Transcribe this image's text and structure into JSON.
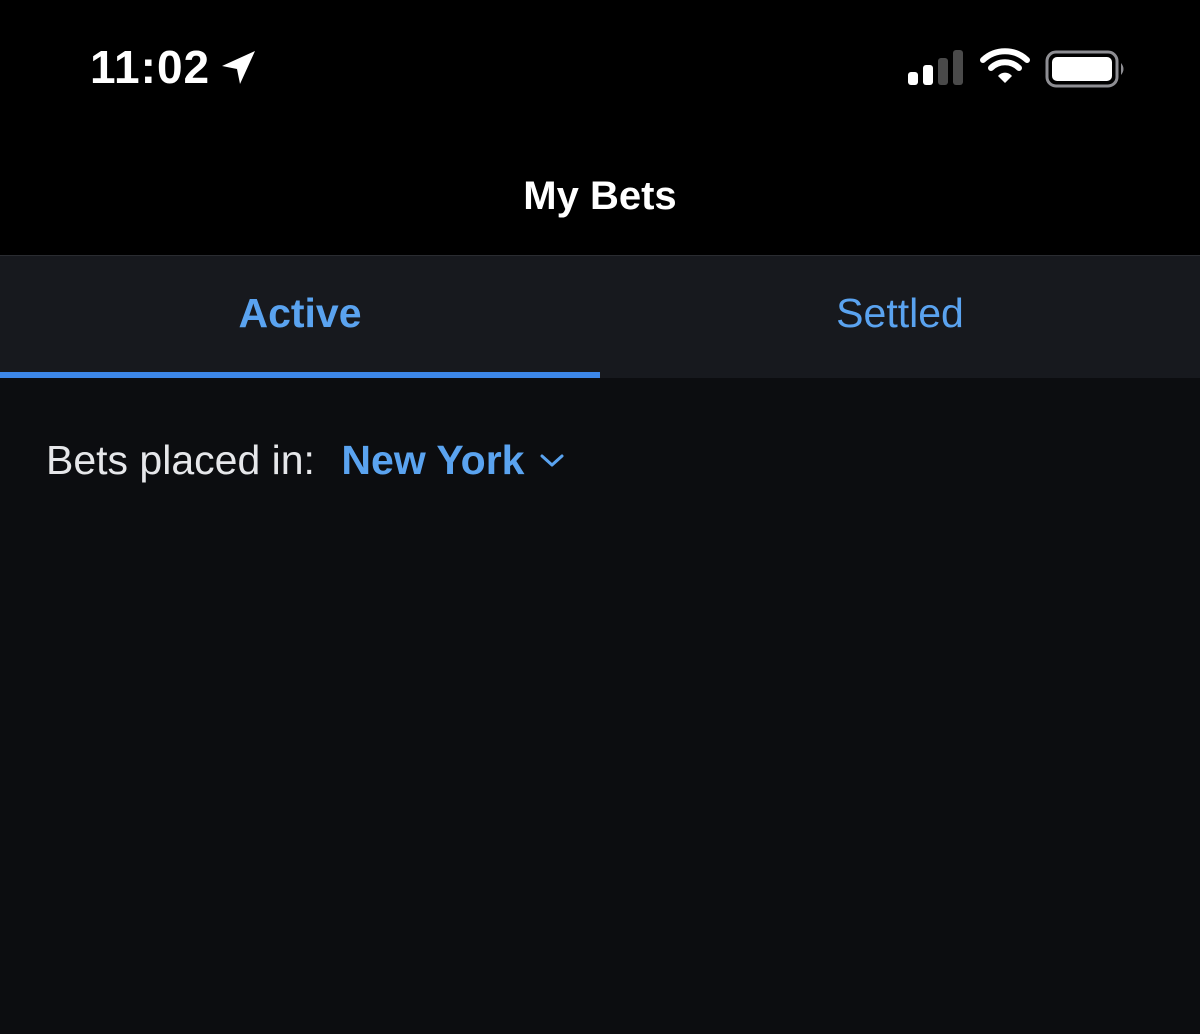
{
  "status_bar": {
    "time": "11:02",
    "icons": [
      "location-arrow-icon",
      "cellular-signal-icon",
      "wifi-icon",
      "battery-icon"
    ]
  },
  "header": {
    "title": "My Bets"
  },
  "tabs": [
    {
      "label": "Active",
      "selected": true
    },
    {
      "label": "Settled",
      "selected": false
    }
  ],
  "filter": {
    "label": "Bets placed in:",
    "value": "New York"
  },
  "colors": {
    "background": "#0c0d10",
    "header_background": "#000000",
    "tab_bar_background": "#17191e",
    "accent": "#5aa3f0",
    "indicator": "#3d87e8",
    "text_primary": "#ffffff"
  }
}
